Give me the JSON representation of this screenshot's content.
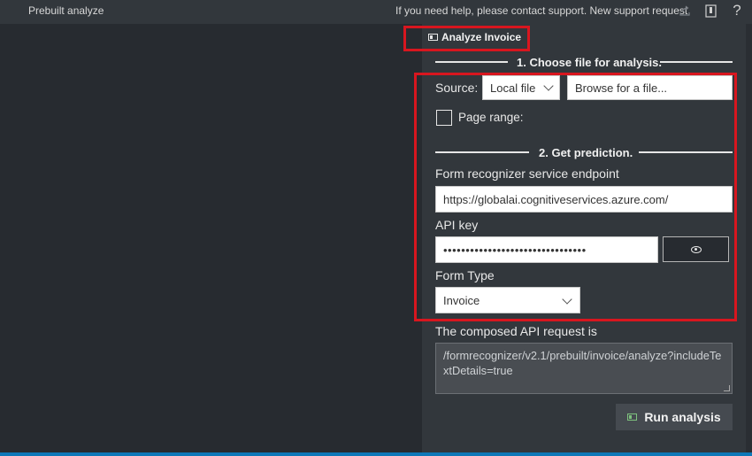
{
  "app": {
    "title": "Prebuilt analyze"
  },
  "topbar": {
    "help_text": "If you need help, please contact support. New support request",
    "icons": [
      "share-icon",
      "panel-icon",
      "help-icon"
    ],
    "help_glyph": "?"
  },
  "panel": {
    "tab_label": "Analyze Invoice",
    "section1_title": "1. Choose file for analysis.",
    "source_label": "Source:",
    "source_value": "Local file",
    "browse_placeholder": "Browse for a file...",
    "page_range_label": "Page range:",
    "section2_title": "2. Get prediction.",
    "endpoint_label": "Form recognizer service endpoint",
    "endpoint_value": "https://globalai.cognitiveservices.azure.com/",
    "api_key_label": "API key",
    "api_key_value": "••••••••••••••••••••••••••••••••",
    "form_type_label": "Form Type",
    "form_type_value": "Invoice",
    "composed_label": "The composed API request is",
    "composed_value": "/formrecognizer/v2.1/prebuilt/invoice/analyze?includeTextDetails=true",
    "run_label": "Run analysis"
  },
  "colors": {
    "highlight": "#d8161f",
    "accent_blue": "#0e78b8",
    "panel_bg": "#32373c",
    "canvas_bg": "#272b30"
  }
}
